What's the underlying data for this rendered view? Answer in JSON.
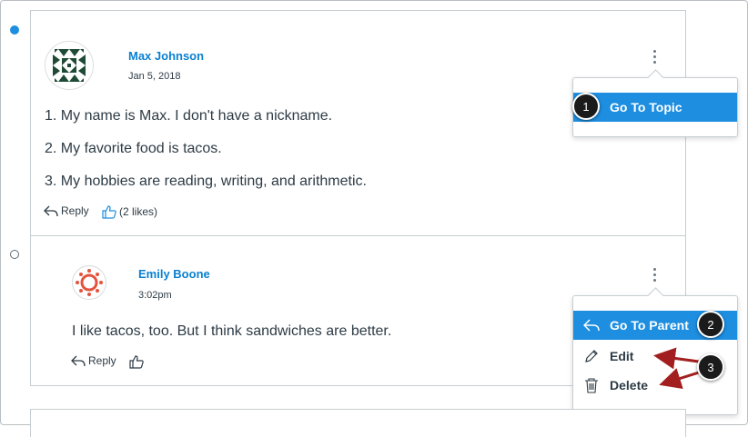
{
  "entries": [
    {
      "author": "Max Johnson",
      "date": "Jan 5, 2018",
      "lines": [
        "1. My name is Max. I don't have a nickname.",
        "2. My favorite food is tacos.",
        "3. My hobbies are reading, writing, and arithmetic."
      ],
      "reply_label": "Reply",
      "likes_label": "(2 likes)"
    },
    {
      "author": "Emily Boone",
      "date": "3:02pm",
      "lines": [
        "I like tacos, too. But I think sandwiches are better."
      ],
      "reply_label": "Reply"
    }
  ],
  "menus": {
    "first": {
      "items": [
        {
          "label": "Go To Topic",
          "active": true
        }
      ]
    },
    "second": {
      "items": [
        {
          "label": "Go To Parent",
          "active": true,
          "icon": "reply-arrow-icon"
        },
        {
          "label": "Edit",
          "icon": "pencil-icon"
        },
        {
          "label": "Delete",
          "icon": "trash-icon"
        }
      ]
    }
  },
  "callouts": [
    "1",
    "2",
    "3"
  ],
  "colors": {
    "accent": "#1d8ee0",
    "link": "#0a81d1",
    "arrow": "#a31f1f",
    "text": "#2d3b45"
  }
}
